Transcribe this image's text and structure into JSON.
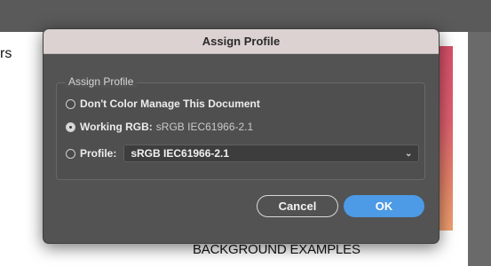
{
  "background": {
    "edge_text": "rs",
    "bottom_text": "BACKGROUND EXAMPLES"
  },
  "dialog": {
    "title": "Assign Profile",
    "group_label": "Assign Profile",
    "options": {
      "dont_manage": {
        "label": "Don't Color Manage This Document",
        "selected": false
      },
      "working_rgb": {
        "label": "Working RGB:",
        "value": "sRGB IEC61966-2.1",
        "selected": true
      },
      "profile": {
        "label": "Profile:",
        "selected": false
      }
    },
    "profile_select": {
      "value": "sRGB IEC61966-2.1"
    },
    "buttons": {
      "cancel": "Cancel",
      "ok": "OK"
    }
  },
  "colors": {
    "accent": "#4d9ae6",
    "dialog_bg": "#535353",
    "titlebar_bg": "#dcd2d1"
  }
}
